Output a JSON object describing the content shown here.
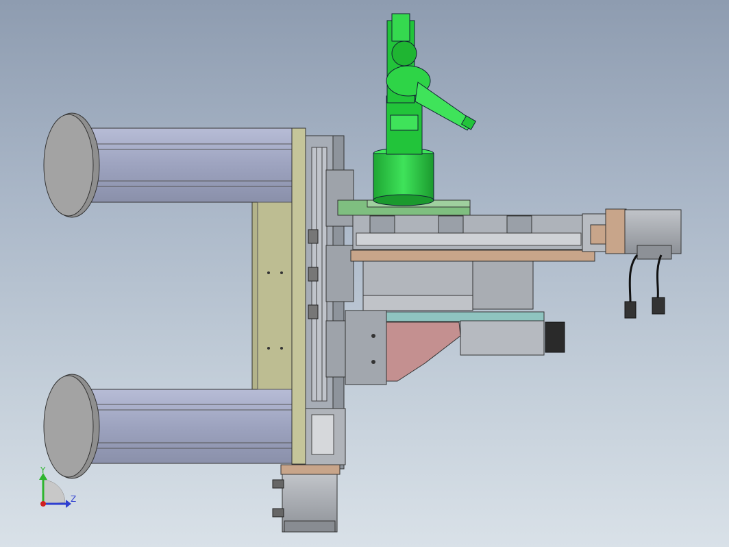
{
  "viewport": {
    "background_top": "#8e9cb0",
    "background_bottom": "#d9e1e8"
  },
  "triad": {
    "y_label": "Y",
    "z_label": "Z",
    "y_color": "#2fb52f",
    "z_color": "#2f3fd0",
    "x_color": "#d02020"
  },
  "colors": {
    "robot": "#22c43a",
    "robot_dark": "#178a28",
    "plate_olive": "#b9b98a",
    "frame_gray": "#9aa0aa",
    "cylinder": "#9da3bf",
    "disc": "#9b9b9b",
    "copper": "#c8a58a",
    "pink": "#c49090",
    "motor": "#a3a7ad",
    "teal": "#8fc4c0",
    "green_plate": "#7fbf80"
  }
}
